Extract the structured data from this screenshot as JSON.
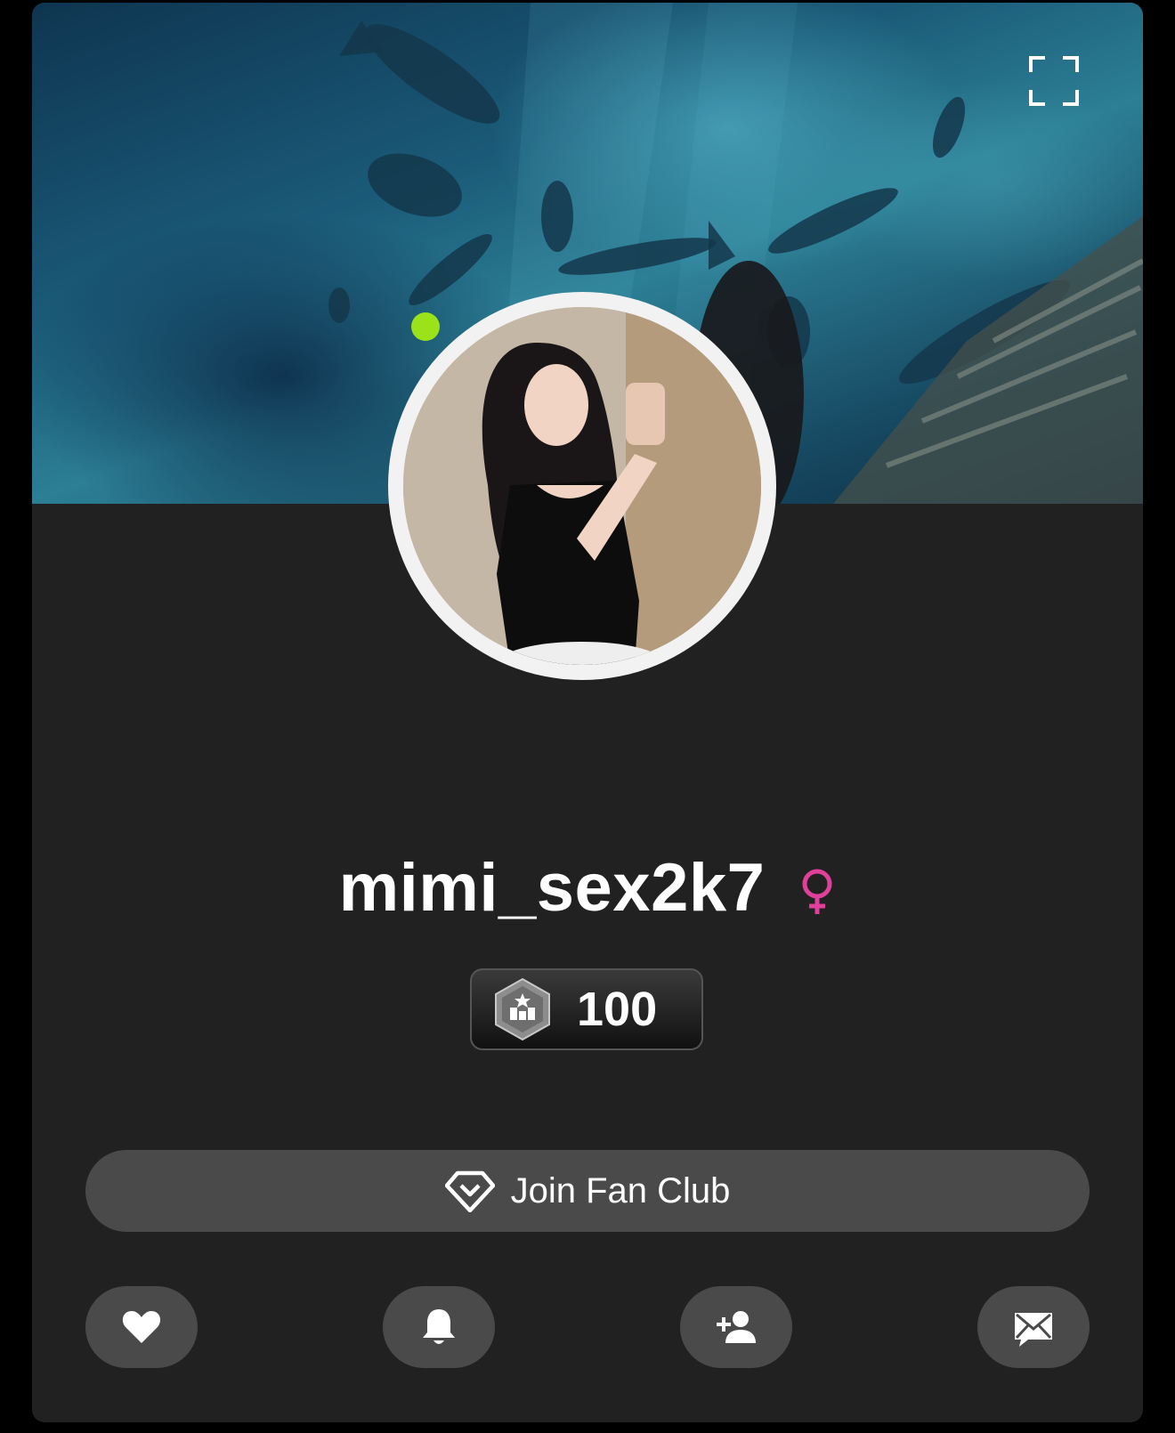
{
  "profile": {
    "username": "mimi_sex2k7",
    "gender": "female",
    "online": true,
    "level": "100"
  },
  "buttons": {
    "fan_club_label": "Join Fan Club"
  },
  "icons": {
    "expand": "expand-icon",
    "gender": "female-icon",
    "level": "level-badge-icon",
    "fan_club": "diamond-icon",
    "like": "heart-icon",
    "notify": "bell-icon",
    "follow": "add-user-icon",
    "message": "mail-icon"
  },
  "colors": {
    "background": "#212121",
    "button": "#4a4a4a",
    "online": "#9be21a",
    "gender": "#e0409a"
  }
}
